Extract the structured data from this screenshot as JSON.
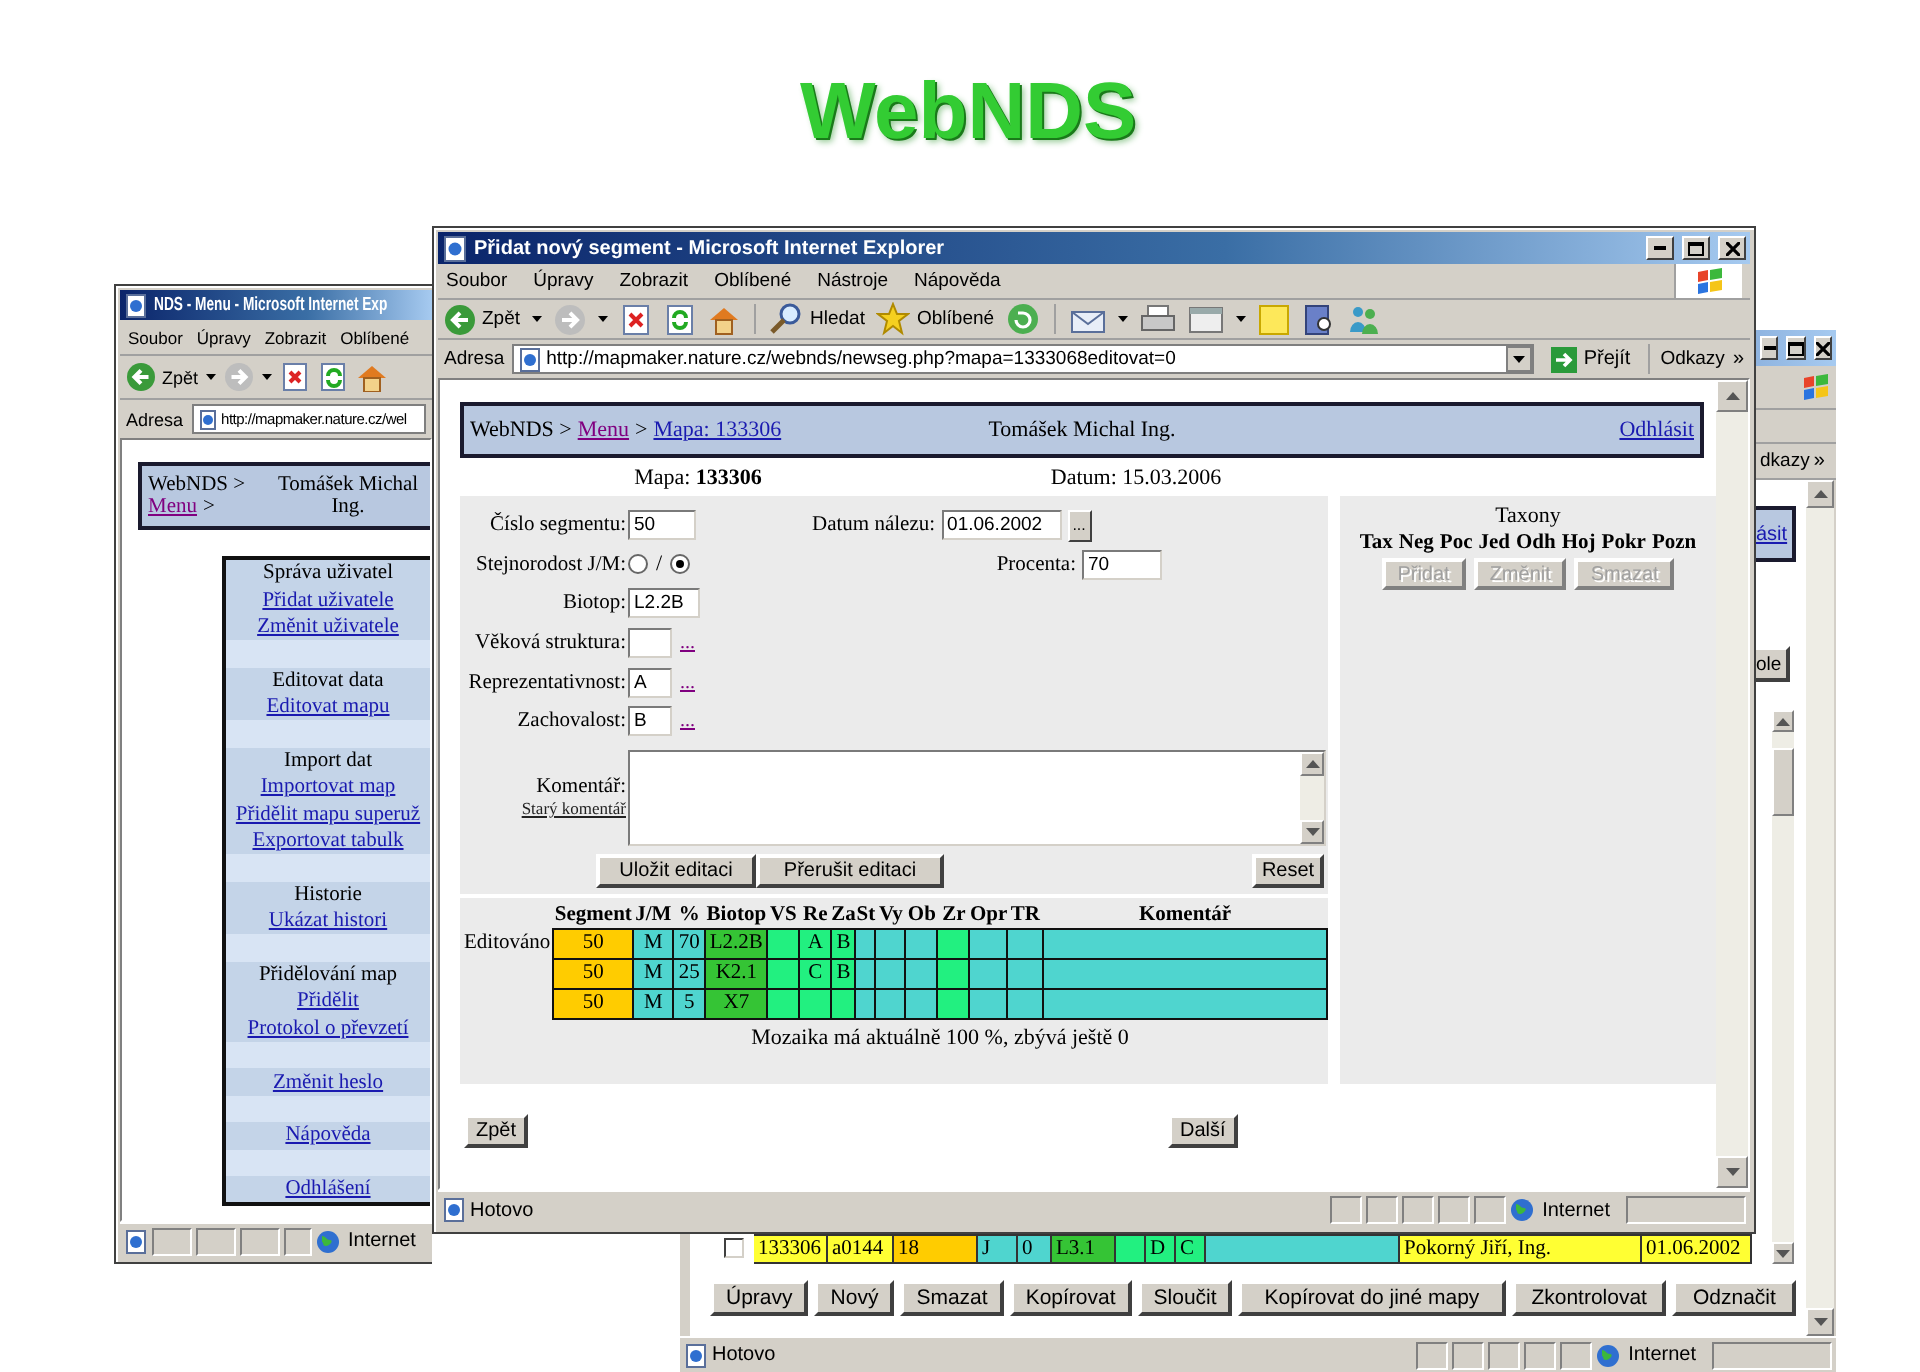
{
  "slide_title": "WebNDS",
  "menu_window": {
    "title": "NDS - Menu - Microsoft Internet Exp",
    "menus": [
      "Soubor",
      "Úpravy",
      "Zobrazit",
      "Oblíbené"
    ],
    "back": "Zpět",
    "address_label": "Adresa",
    "url": "http://mapmaker.nature.cz/wel",
    "header": {
      "root": "WebNDS >",
      "link": "Menu",
      "separator": ">",
      "user": [
        "Tomášek Michal",
        "Ing."
      ]
    },
    "sections": [
      {
        "heading": "Správa uživatel",
        "links": [
          "Přidat uživatele",
          "Změnit uživatele"
        ]
      },
      {
        "heading": "Editovat data",
        "links": [
          "Editovat mapu"
        ]
      },
      {
        "heading": "Import dat",
        "links": [
          "Importovat map",
          "Přidělit mapu superuž",
          "Exportovat tabulk"
        ]
      },
      {
        "heading": "Historie",
        "links": [
          "Ukázat histori"
        ]
      },
      {
        "heading": "Přidělování map",
        "links": [
          "Přidělit",
          "Protokol o převzetí"
        ]
      },
      {
        "links": [
          "Změnit heslo"
        ]
      },
      {
        "links": [
          "Nápověda"
        ]
      },
      {
        "links": [
          "Odhlášení"
        ]
      }
    ],
    "zone": "Internet"
  },
  "edit_window": {
    "title": "Přidat nový segment - Microsoft Internet Explorer",
    "menus": [
      "Soubor",
      "Úpravy",
      "Zobrazit",
      "Oblíbené",
      "Nástroje",
      "Nápověda"
    ],
    "toolbar": {
      "back": "Zpět",
      "search": "Hledat",
      "favorites": "Oblíbené"
    },
    "address_label": "Adresa",
    "url": "http://mapmaker.nature.cz/webnds/newseg.php?mapa=1333068editovat=0",
    "go": "Přejít",
    "links": "Odkazy",
    "more": "»",
    "header": {
      "root": "WebNDS >",
      "separator": ">",
      "links": [
        {
          "text": "Menu",
          "visited": true
        },
        {
          "text": "Mapa: 133306",
          "visited": false
        }
      ],
      "user": "Tomášek Michal Ing.",
      "logout": "Odhlásit"
    },
    "map": "Mapa: **133306**",
    "date": "Datum: 15.03.2006",
    "fields": [
      {
        "label": "Číslo segmentu:",
        "kind": "text",
        "value": "50"
      },
      {
        "label": "Stejnorodost J/M:",
        "kind": "radio",
        "options": [
          {
            "selected": false
          },
          {
            "selected": true
          }
        ],
        "separator": "/"
      },
      {
        "label": "Biotop:",
        "kind": "text",
        "value": "L2.2B"
      },
      {
        "label": "Věková struktura:",
        "kind": "picker",
        "link": "..."
      },
      {
        "label": "Reprezentativnost:",
        "kind": "picker",
        "value": "A",
        "link": "..."
      },
      {
        "label": "Zachovalost:",
        "kind": "picker",
        "value": "B",
        "link": "..."
      }
    ],
    "found_date": {
      "label": "Datum nálezu:",
      "value": "01.06.2002",
      "button": "..."
    },
    "percent": {
      "label": "Procenta:",
      "value": "70"
    },
    "comment": {
      "label": "Komentář:",
      "link": "Starý komentář"
    },
    "actions": [
      "Uložit editaci",
      "Přerušit editaci"
    ],
    "reset": "Reset",
    "taxa": {
      "title": "Taxony",
      "columns": [
        "Tax",
        "Neg",
        "Poc",
        "Jed",
        "Odh",
        "Hoj",
        "Pokr",
        "Pozn"
      ],
      "buttons": [
        {
          "label": "Přidat",
          "disabled": true
        },
        {
          "label": "Změnit",
          "disabled": true
        },
        {
          "label": "Smazat",
          "disabled": true
        }
      ]
    },
    "segments": {
      "columns": [
        "Segment",
        "J/M",
        "%",
        "Biotop",
        "VS",
        "Re",
        "Za",
        "St",
        "Vy",
        "Ob",
        "Zr",
        "Opr",
        "TR",
        "Komentář"
      ],
      "rows": [
        {
          "label": "Editováno",
          "cells": [
            {
              "text": "50",
              "color": "#ffcc00"
            },
            {
              "text": "M",
              "color": "#4fd5cf"
            },
            {
              "text": "70",
              "color": "#4fd5cf"
            },
            {
              "text": "L2.2B",
              "color": "#35c435"
            },
            {
              "color": "#22f080"
            },
            {
              "text": "A",
              "color": "#22f080"
            },
            {
              "text": "B",
              "color": "#22f080"
            },
            {
              "color": "#4fd5cf"
            },
            {
              "color": "#4fd5cf"
            },
            {
              "color": "#4fd5cf"
            },
            {
              "color": "#22f080"
            },
            {
              "color": "#4fd5cf"
            },
            {
              "color": "#4fd5cf"
            },
            {
              "color": "#4fd5cf"
            }
          ]
        },
        {
          "cells": [
            {
              "text": "50",
              "color": "#ffcc00"
            },
            {
              "text": "M",
              "color": "#4fd5cf"
            },
            {
              "text": "25",
              "color": "#4fd5cf"
            },
            {
              "text": "K2.1",
              "color": "#35c435"
            },
            {
              "color": "#22f080"
            },
            {
              "text": "C",
              "color": "#22f080"
            },
            {
              "text": "B",
              "color": "#22f080"
            },
            {
              "color": "#4fd5cf"
            },
            {
              "color": "#4fd5cf"
            },
            {
              "color": "#4fd5cf"
            },
            {
              "color": "#22f080"
            },
            {
              "color": "#4fd5cf"
            },
            {
              "color": "#4fd5cf"
            },
            {
              "color": "#4fd5cf"
            }
          ]
        },
        {
          "cells": [
            {
              "text": "50",
              "color": "#ffcc00"
            },
            {
              "text": "M",
              "color": "#4fd5cf"
            },
            {
              "text": "5",
              "color": "#4fd5cf"
            },
            {
              "text": "X7",
              "color": "#35c435"
            },
            {
              "color": "#22f080"
            },
            {
              "color": "#22f080"
            },
            {
              "color": "#22f080"
            },
            {
              "color": "#4fd5cf"
            },
            {
              "color": "#4fd5cf"
            },
            {
              "color": "#4fd5cf"
            },
            {
              "color": "#22f080"
            },
            {
              "color": "#4fd5cf"
            },
            {
              "color": "#4fd5cf"
            },
            {
              "color": "#4fd5cf"
            }
          ]
        }
      ],
      "summary": "Mozaika má aktuálně 100 %, zbývá ještě 0"
    },
    "nav": {
      "back": "Zpět",
      "next": "Další"
    },
    "status": "Hotovo",
    "zone": "Internet"
  },
  "list_window": {
    "links_fragment": "dkazy",
    "more": "»",
    "logout_fragment": "ásit",
    "button_fragment": "ole",
    "row": {
      "checked": false,
      "cells": [
        {
          "text": "133306",
          "color": "#ffff33"
        },
        {
          "text": "a0144",
          "color": "#ffff33"
        },
        {
          "text": "18",
          "color": "#ffcc00"
        },
        {
          "text": "J",
          "color": "#4fd5cf"
        },
        {
          "text": "0",
          "color": "#4fd5cf"
        },
        {
          "text": "L3.1",
          "color": "#35c435"
        },
        {
          "color": "#22f080"
        },
        {
          "text": "D",
          "color": "#22f080"
        },
        {
          "text": "C",
          "color": "#22f080"
        },
        {
          "color": "#4fd5cf"
        },
        {
          "text": "Pokorný Jiří, Ing.",
          "color": "#ffff33"
        },
        {
          "text": "01.06.2002",
          "color": "#ffff33"
        }
      ]
    },
    "buttons": [
      "Úpravy",
      "Nový",
      "Smazat",
      "Kopírovat",
      "Sloučit",
      "Kopírovat do jiné mapy"
    ],
    "right_buttons": [
      "Zkontrolovat",
      "Odznačit"
    ],
    "status": "Hotovo",
    "zone": "Internet"
  }
}
